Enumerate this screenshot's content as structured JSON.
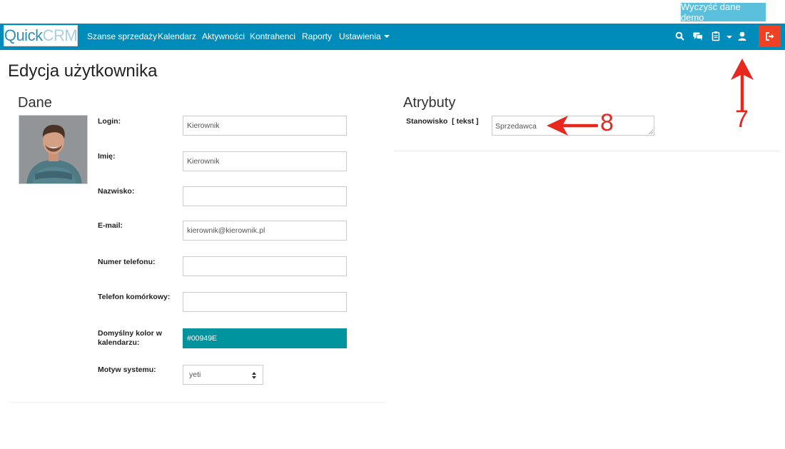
{
  "top": {
    "demo_button": "Wyczyść dane demo"
  },
  "navbar": {
    "logo_part1": "Quick",
    "logo_part2": "CRM",
    "items": [
      "Szanse sprzedaży",
      "Kalendarz",
      "Aktywności",
      "Kontrahenci",
      "Raporty",
      "Ustawienia"
    ],
    "icons": [
      "search-icon",
      "chat-icon",
      "clipboard-icon",
      "user-icon",
      "logout-icon"
    ]
  },
  "page": {
    "title": "Edycja użytkownika"
  },
  "dane": {
    "title": "Dane",
    "fields": {
      "login": {
        "label": "Login:",
        "value": "Kierownik"
      },
      "imie": {
        "label": "Imię:",
        "value": "Kierownik"
      },
      "nazwisko": {
        "label": "Nazwisko:",
        "value": ""
      },
      "email": {
        "label": "E-mail:",
        "value": "kierownik@kierownik.pl"
      },
      "telefon": {
        "label": "Numer telefonu:",
        "value": ""
      },
      "komorkowy": {
        "label": "Telefon komórkowy:",
        "value": ""
      },
      "kolor": {
        "label_line1": "Domyślny kolor w",
        "label_line2": "kalendarzu:",
        "value": "#00949E"
      },
      "motyw": {
        "label": "Motyw systemu:",
        "value": "yeti"
      }
    }
  },
  "atrybuty": {
    "title": "Atrybuty",
    "stanowisko": {
      "label": "Stanowisko  [ tekst ]",
      "value": "Sprzedawca"
    }
  },
  "annotations": {
    "arrow_7": "7",
    "arrow_8": "8"
  },
  "colors": {
    "navbar": "#008cba",
    "demo_button": "#5bc0de",
    "logout": "#f04124",
    "calendar_color": "#00949e",
    "annotation": "#e8281e"
  }
}
